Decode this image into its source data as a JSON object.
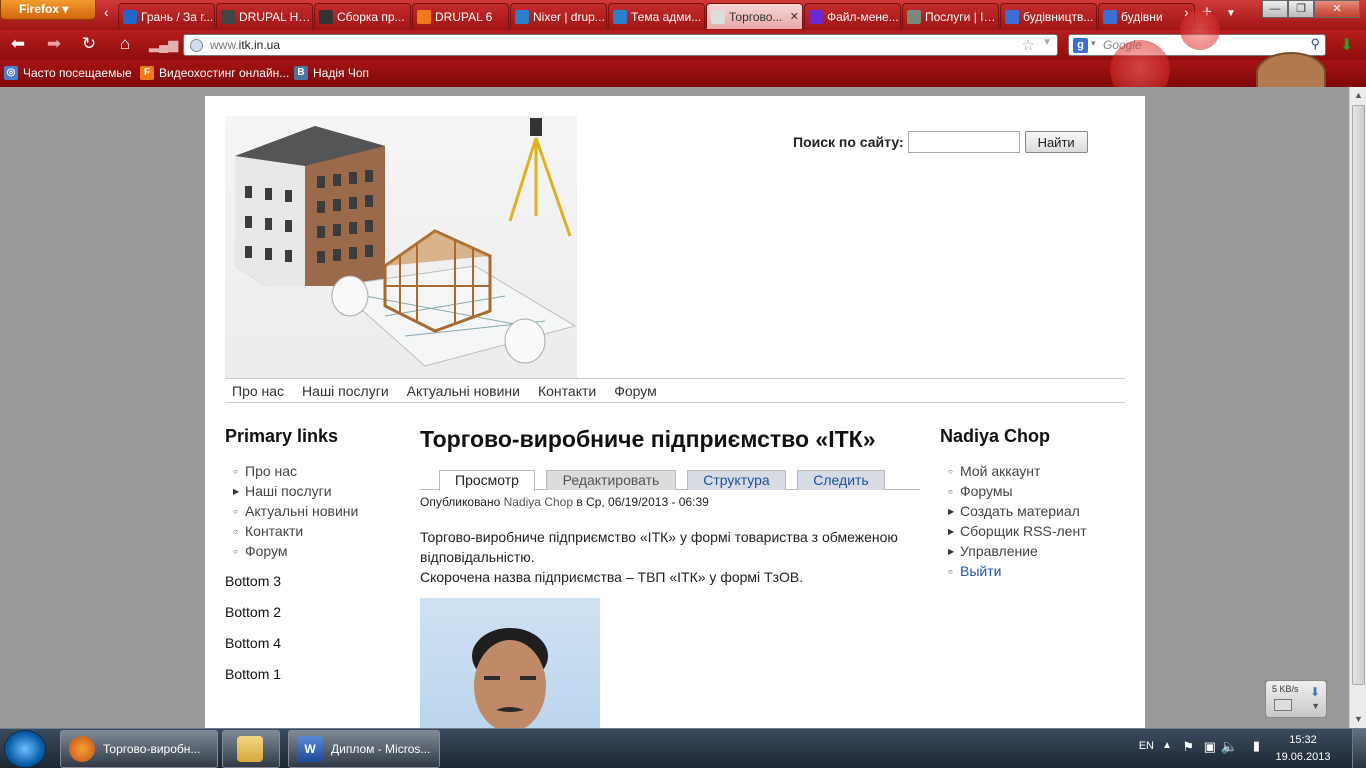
{
  "browser": {
    "menu_button": "Firefox",
    "tabs": [
      {
        "label": "Грань / За г...",
        "icon_color": "#2266cc"
      },
      {
        "label": "DRUPAL НА...",
        "icon_color": "#444444"
      },
      {
        "label": "Сборка пр...",
        "icon_color": "#333333"
      },
      {
        "label": "DRUPAL 6",
        "icon_color": "#f07a1a"
      },
      {
        "label": "Nixer | drup...",
        "icon_color": "#2c7fc9"
      },
      {
        "label": "Тема адми...",
        "icon_color": "#2c7fc9"
      },
      {
        "label": "Торгово...",
        "icon_color": "#dddddd",
        "active": true
      },
      {
        "label": "Файл-мене...",
        "icon_color": "#6a2ad0"
      },
      {
        "label": "Послуги | ITK",
        "icon_color": "#7a8a7a"
      },
      {
        "label": "будівництв...",
        "icon_color": "#3b6fd4"
      },
      {
        "label": "будівни",
        "icon_color": "#3b6fd4"
      }
    ],
    "url_prefix": "www.",
    "url_host": "itk.in.ua",
    "search_placeholder": "Google",
    "bookmarks": [
      {
        "label": "Часто посещаемые",
        "icon": "bookmark-folder-icon"
      },
      {
        "label": "Видеохостинг онлайн...",
        "icon": "f-logo-icon"
      },
      {
        "label": "Надія Чоп",
        "icon": "vk-icon"
      }
    ]
  },
  "site": {
    "search_label": "Поиск по сайту:",
    "search_value": "",
    "search_button": "Найти",
    "primary_menu": [
      "Про нас",
      "Наші послуги",
      "Актуальні новини",
      "Контакти",
      "Форум"
    ],
    "left_block": {
      "title": "Primary links",
      "items": [
        {
          "label": "Про нас",
          "bullet": "circle"
        },
        {
          "label": "Наші послуги",
          "bullet": "arrow"
        },
        {
          "label": "Актуальні новини",
          "bullet": "circle"
        },
        {
          "label": "Контакти",
          "bullet": "circle"
        },
        {
          "label": "Форум",
          "bullet": "circle"
        }
      ],
      "bottoms": [
        "Bottom 3",
        "Bottom 2",
        "Bottom 4",
        "Bottom 1"
      ]
    },
    "node": {
      "title": "Торгово-виробниче підприємство «ІТК»",
      "tabs": [
        "Просмотр",
        "Редактировать",
        "Структура",
        "Следить"
      ],
      "meta_prefix": "Опубликовано",
      "meta_author": "Nadiya Chop",
      "meta_suffix": "в Ср, 06/19/2013 - 06:39",
      "paragraph1": "Торгово-виробниче підприємство «ІТК» у формі товариства з обмеженою відповідальністю.",
      "paragraph2": "Скорочена назва підприємства – ТВП «ІТК» у формі ТзОВ."
    },
    "right_block": {
      "title": "Nadiya Chop",
      "items": [
        {
          "label": "Мой аккаунт",
          "bullet": "circle"
        },
        {
          "label": "Форумы",
          "bullet": "circle"
        },
        {
          "label": "Создать материал",
          "bullet": "arrow"
        },
        {
          "label": "Сборщик RSS-лент",
          "bullet": "arrow"
        },
        {
          "label": "Управление",
          "bullet": "arrow"
        },
        {
          "label": "Выйти",
          "bullet": "circle"
        }
      ]
    }
  },
  "download_widget": "5 KB/s",
  "taskbar": {
    "items": [
      {
        "label": "Торгово-виробн...",
        "icon_color": "#e8641b"
      },
      {
        "label": "",
        "icon_color": "#e6c46a"
      },
      {
        "label": "Диплом - Micros...",
        "icon_color": "#2b5797"
      }
    ],
    "lang": "EN",
    "time": "15:32",
    "date": "19.06.2013"
  }
}
